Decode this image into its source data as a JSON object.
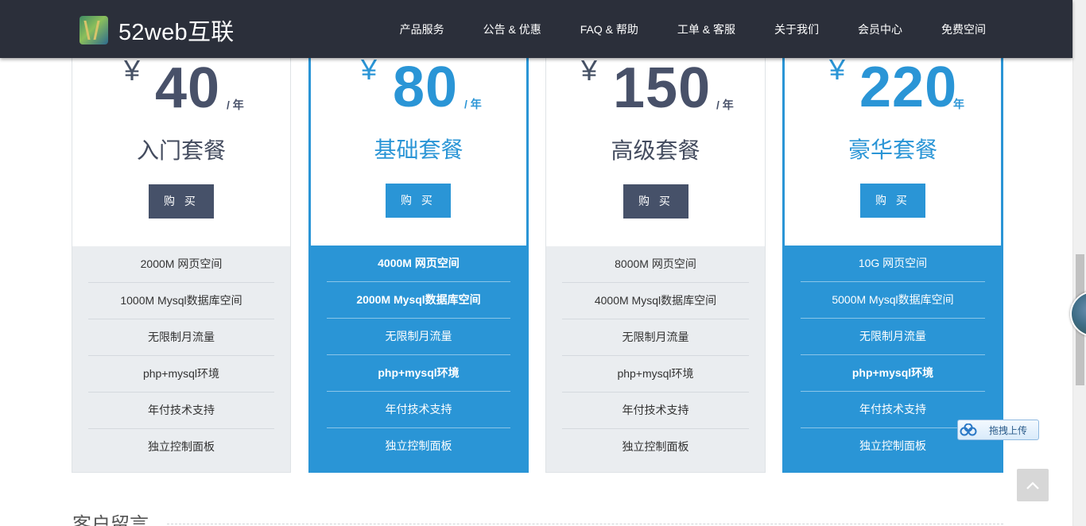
{
  "header": {
    "logo_text": "52web互联",
    "nav": [
      "产品服务",
      "公告 & 优惠",
      "FAQ & 帮助",
      "工单 & 客服",
      "关于我们",
      "会员中心",
      "免费空间"
    ]
  },
  "plans": [
    {
      "currency": "¥",
      "price": "40",
      "period": "/ 年",
      "name": "入门套餐",
      "buy_label": "购 买",
      "features": [
        "2000M 网页空间",
        "1000M Mysql数据库空间",
        "无限制月流量",
        "php+mysql环境",
        "年付技术支持",
        "独立控制面板"
      ]
    },
    {
      "currency": "¥",
      "price": "80",
      "period": "/ 年",
      "name": "基础套餐",
      "buy_label": "购 买",
      "features": [
        "4000M 网页空间",
        "2000M Mysql数据库空间",
        "无限制月流量",
        "php+mysql环境",
        "年付技术支持",
        "独立控制面板"
      ]
    },
    {
      "currency": "¥",
      "price": "150",
      "period": "/ 年",
      "name": "高级套餐",
      "buy_label": "购 买",
      "features": [
        "8000M 网页空间",
        "4000M Mysql数据库空间",
        "无限制月流量",
        "php+mysql环境",
        "年付技术支持",
        "独立控制面板"
      ]
    },
    {
      "currency": "¥",
      "price": "220",
      "period": "年",
      "name": "豪华套餐",
      "buy_label": "购 买",
      "features": [
        "10G 网页空间",
        "5000M Mysql数据库空间",
        "无限制月流量",
        "php+mysql环境",
        "年付技术支持",
        "独立控制面板"
      ]
    }
  ],
  "section": {
    "title": "客户留言"
  },
  "widgets": {
    "upload_label": "拖拽上传"
  },
  "colors": {
    "header_bg": "#2b2f3a",
    "accent_blue": "#2a95d6",
    "slate": "#465169",
    "feature_bg": "#eaedf0"
  }
}
